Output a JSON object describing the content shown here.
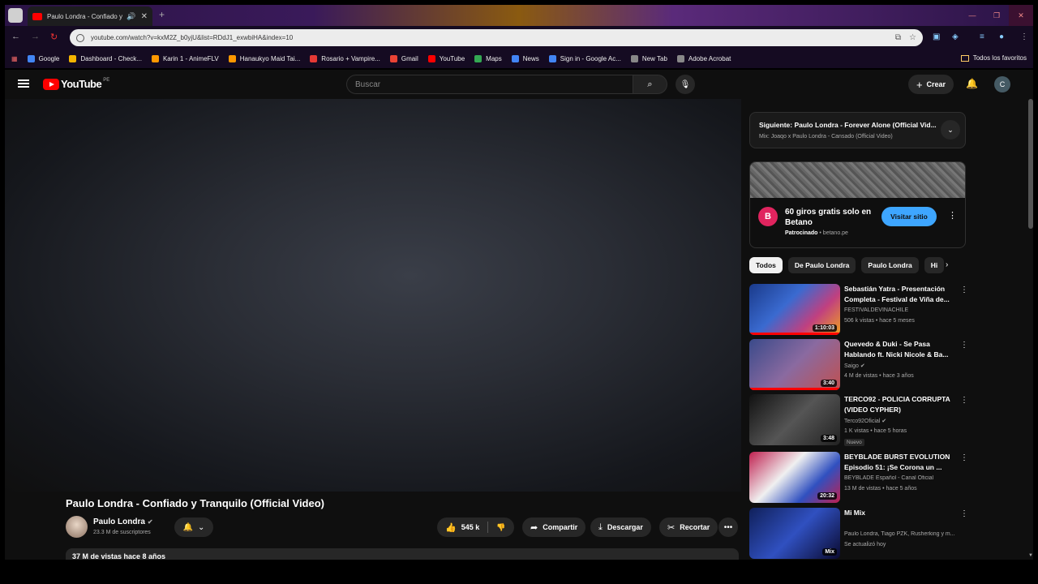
{
  "browser": {
    "tab_title": "Paulo Londra - Confiado y Tranquilo",
    "url": "youtube.com/watch?v=kxM2Z_b0yjU&list=RDdJ1_exwbiHA&index=10",
    "bookmarks": [
      {
        "label": "Google",
        "color": "#4285f4"
      },
      {
        "label": "Dashboard - Check...",
        "color": "#f4b400"
      },
      {
        "label": "Karin 1 - AnimeFLV",
        "color": "#ff9800"
      },
      {
        "label": "Hanaukyo Maid Tai...",
        "color": "#ff9800"
      },
      {
        "label": "Rosario + Vampire...",
        "color": "#e53935"
      },
      {
        "label": "Gmail",
        "color": "#ea4335"
      },
      {
        "label": "YouTube",
        "color": "#ff0000"
      },
      {
        "label": "Maps",
        "color": "#34a853"
      },
      {
        "label": "News",
        "color": "#4285f4"
      },
      {
        "label": "Sign in - Google Ac...",
        "color": "#4285f4"
      },
      {
        "label": "New Tab",
        "color": "#888888"
      },
      {
        "label": "Adobe Acrobat",
        "color": "#888888"
      }
    ],
    "all_bookmarks": "Todos los favoritos"
  },
  "youtube": {
    "logo": "YouTube",
    "country": "PE",
    "search_placeholder": "Buscar",
    "create_label": "Crear",
    "avatar_letter": "C"
  },
  "video": {
    "title": "Paulo Londra - Confiado y Tranquilo (Official Video)",
    "channel": "Paulo Londra",
    "subscribers": "23.3 M de suscriptores",
    "likes": "545 k",
    "share": "Compartir",
    "download": "Descargar",
    "clip": "Recortar",
    "views_date": "37 M de vistas  hace 8 años"
  },
  "up_next": {
    "line1": "Siguiente: Paulo Londra - Forever Alone (Official Vid...",
    "line2": "Mix: Joaqo x Paulo Londra - Cansado (Official Video)"
  },
  "ad": {
    "logo_letter": "B",
    "headline": "60 giros gratis solo en Betano",
    "sponsored": "Patrocinado",
    "domain": "betano.pe",
    "cta": "Visitar sitio"
  },
  "chips": [
    "Todos",
    "De Paulo Londra",
    "Paulo Londra",
    "Hi"
  ],
  "recommendations": [
    {
      "title": "Sebastián Yatra - Presentación Completa - Festival de Viña de...",
      "channel": "FESTIVALDEVINACHILE",
      "meta": "506 k vistas • hace 5 meses",
      "duration": "1:10:03",
      "verified": false,
      "badge": "",
      "thumb": "linear-gradient(135deg,#1a3a8a,#3a6ad0 40%,#c04080 70%,#f0a020)",
      "progress": 1.0
    },
    {
      "title": "Quevedo & Duki - Se Pasa Hablando ft. Nicki Nicole & Ba...",
      "channel": "Saigo",
      "meta": "4 M de vistas • hace 3 años",
      "duration": "3:40",
      "verified": true,
      "badge": "",
      "thumb": "linear-gradient(135deg,#3a4a8a,#8a6aa0 50%,#c05050)",
      "progress": 1.0
    },
    {
      "title": "TERCO92 - POLICIA CORRUPTA (VIDEO CYPHER)",
      "channel": "Terco92Oficial",
      "meta": "1 K vistas • hace 5 horas",
      "duration": "3:48",
      "verified": true,
      "badge": "Nuevo",
      "thumb": "linear-gradient(135deg,#111,#555 50%,#222)",
      "progress": 0
    },
    {
      "title": "BEYBLADE BURST EVOLUTION Episodio 51: ¡Se Corona un ...",
      "channel": "BEYBLADE Español - Canal Oficial",
      "meta": "13 M de vistas • hace 5 años",
      "duration": "20:32",
      "verified": false,
      "badge": "",
      "thumb": "linear-gradient(135deg,#c02050,#f0f0f0 40%,#3050c0 70%,#c02050)",
      "progress": 0
    },
    {
      "title": "Mi Mix",
      "channel": "Paulo Londra, Tiago PZK, Rusherking y m...",
      "meta": "Se actualizó hoy",
      "duration": "Mix",
      "verified": false,
      "badge": "",
      "thumb": "linear-gradient(135deg,#10205a,#3050c0 50%,#0a0a30)",
      "progress": 0
    }
  ]
}
